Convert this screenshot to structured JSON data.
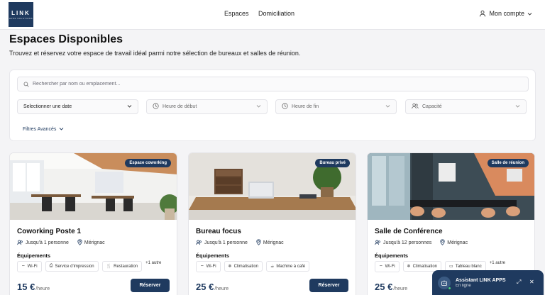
{
  "brand": {
    "logo_main": "LINK",
    "logo_sub": "APPS SOLUTIONS"
  },
  "nav": {
    "items": [
      "Espaces",
      "Domiciliation"
    ],
    "account_label": "Mon compte"
  },
  "page": {
    "title": "Espaces Disponibles",
    "subtitle": "Trouvez et réservez votre espace de travail idéal parmi notre sélection de bureaux et salles de réunion."
  },
  "filters": {
    "search_placeholder": "Rechercher par nom ou emplacement...",
    "date": "Selectionner une date",
    "start": "Heure de début",
    "end": "Heure de fin",
    "capacity": "Capacité",
    "advanced": "Filtres Avancés"
  },
  "cards": [
    {
      "badge": "Espace coworking",
      "title": "Coworking Poste 1",
      "capacity": "Jusqu'à 1 personne",
      "location": "Mérignac",
      "equip_label": "Équipements",
      "equipments": [
        "Wi-Fi",
        "Service d'impression",
        "Restauration"
      ],
      "more": "+1 autre",
      "price": "15 €",
      "unit": "/heure",
      "button": "Réserver"
    },
    {
      "badge": "Bureau privé",
      "title": "Bureau focus",
      "capacity": "Jusqu'à 1 personne",
      "location": "Mérignac",
      "equip_label": "Équipements",
      "equipments": [
        "Wi-Fi",
        "Climatisation",
        "Machine à café"
      ],
      "more": "",
      "price": "25 €",
      "unit": "/heure",
      "button": "Réserver"
    },
    {
      "badge": "Salle de réunion",
      "title": "Salle de Conférence",
      "capacity": "Jusqu'à 12 personnes",
      "location": "Mérignac",
      "equip_label": "Équipements",
      "equipments": [
        "Wi-Fi",
        "Climatisation",
        "Tableau blanc"
      ],
      "more": "+1 autre",
      "price": "25 €",
      "unit": "/heure",
      "button": ""
    }
  ],
  "assistant": {
    "title": "Assistant LINK APPS",
    "status": "En ligne"
  },
  "colors": {
    "primary": "#1f3a5f",
    "online": "#4bd37b"
  }
}
